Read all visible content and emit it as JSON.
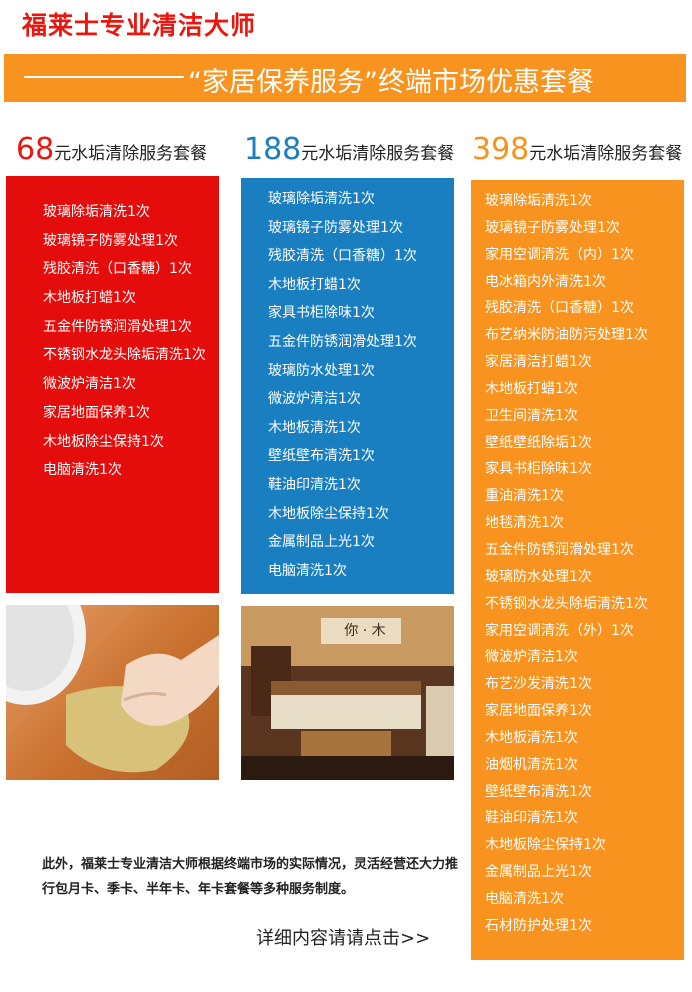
{
  "header": {
    "brand": "福莱士专业清洁大师",
    "banner_title": "“家居保养服务”终端市场优惠套餐"
  },
  "packages": [
    {
      "price": "68",
      "label": "元水垢清除服务套餐",
      "items": [
        "玻璃除垢清洗1次",
        "玻璃镜子防雾处理1次",
        "残胶清洗（口香糖）1次",
        "木地板打蜡1次",
        "五金件防锈润滑处理1次",
        "不锈钢水龙头除垢清洗1次",
        "微波炉清洁1次",
        "家居地面保养1次",
        "木地板除尘保持1次",
        "电脑清洗1次"
      ]
    },
    {
      "price": "188",
      "label": "元水垢清除服务套餐",
      "items": [
        "玻璃除垢清洗1次",
        "玻璃镜子防雾处理1次",
        "残胶清洗（口香糖）1次",
        "木地板打蜡1次",
        "家具书柜除味1次",
        "五金件防锈润滑处理1次",
        "玻璃防水处理1次",
        "微波炉清洁1次",
        "木地板清洗1次",
        "壁纸壁布清洗1次",
        "鞋油印清洗1次",
        "木地板除尘保持1次",
        "金属制品上光1次",
        "电脑清洗1次"
      ]
    },
    {
      "price": "398",
      "label": "元水垢清除服务套餐",
      "items": [
        "玻璃除垢清洗1次",
        "玻璃镜子防雾处理1次",
        "家用空调清洗（内）1次",
        "电冰箱内外清洗1次",
        "残胶清洗（口香糖）1次",
        "布艺纳米防油防污处理1次",
        "家居清洁打蜡1次",
        "木地板打蜡1次",
        "卫生间清洗1次",
        "壁纸壁纸除垢1次",
        "家具书柜除味1次",
        "重油清洗1次",
        "地毯清洗1次",
        "五金件防锈润滑处理1次",
        "玻璃防水处理1次",
        "不锈钢水龙头除垢清洗1次",
        "家用空调清洗（外）1次",
        "微波炉清洁1次",
        "布艺沙发清洗1次",
        "家居地面保养1次",
        "木地板清洗1次",
        "油烟机清洗1次",
        "壁纸壁布清洗1次",
        "鞋油印清洗1次",
        "木地板除尘保持1次",
        "金属制品上光1次",
        "电脑清洗1次",
        "石材防护处理1次"
      ]
    }
  ],
  "living_room_sign": "你 · 木",
  "footer": {
    "note": "此外，福莱士专业清洁大师根据终端市场的实际情况，灵活经营还大力推行包月卡、季卡、半年卡、年卡套餐等多种服务制度。",
    "more_link": "详细内容请请点击>>"
  },
  "colors": {
    "red": "#e50c0c",
    "blue": "#1a7fc1",
    "orange": "#f7931e"
  }
}
